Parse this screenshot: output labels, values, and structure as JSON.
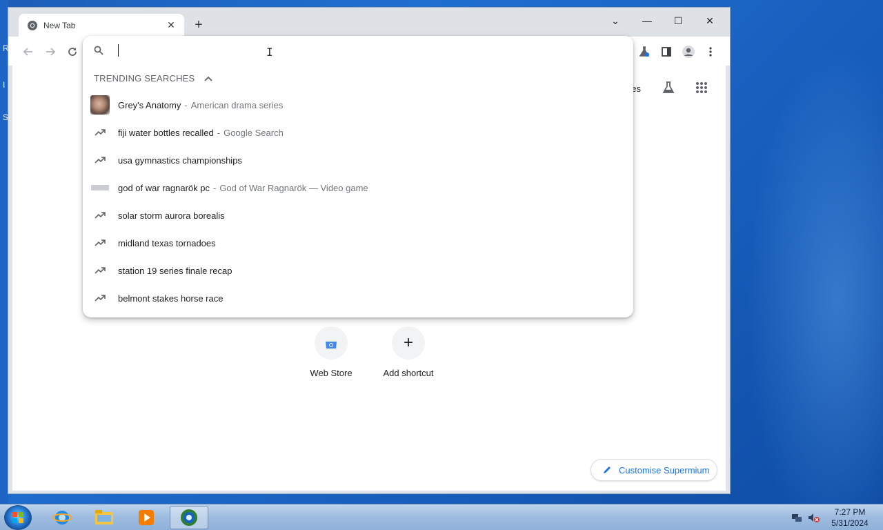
{
  "browser": {
    "tab": {
      "title": "New Tab"
    },
    "new_tab_symbol": "+",
    "window_controls": {
      "tab_search": "⌄",
      "minimize": "—",
      "maximize": "☐",
      "close": "✕"
    }
  },
  "omnibox": {
    "input_value": "",
    "section_title": "TRENDING SEARCHES",
    "suggestions": [
      {
        "main": "Grey's Anatomy",
        "separator": "-",
        "description": "American drama series",
        "icon": "photo-thumbnail"
      },
      {
        "main": "fiji water bottles recalled",
        "separator": "-",
        "description": "Google Search",
        "icon": "trending-icon"
      },
      {
        "main": "usa gymnastics championships",
        "separator": "",
        "description": "",
        "icon": "trending-icon"
      },
      {
        "main": "god of war ragnarök pc",
        "separator": "-",
        "description": "God of War Ragnarök — Video game",
        "icon": "logo-thumbnail"
      },
      {
        "main": "solar storm aurora borealis",
        "separator": "",
        "description": "",
        "icon": "trending-icon"
      },
      {
        "main": "midland texas tornadoes",
        "separator": "",
        "description": "",
        "icon": "trending-icon"
      },
      {
        "main": "station 19 series finale recap",
        "separator": "",
        "description": "",
        "icon": "trending-icon"
      },
      {
        "main": "belmont stakes horse race",
        "separator": "",
        "description": "",
        "icon": "trending-icon"
      }
    ]
  },
  "newtab": {
    "images_link_partial": "ges",
    "shortcuts": [
      {
        "label": "Web Store"
      },
      {
        "label": "Add shortcut",
        "symbol": "+"
      }
    ],
    "customise_label": "Customise Supermium"
  },
  "taskbar": {
    "time": "7:27 PM",
    "date": "5/31/2024"
  },
  "colors": {
    "accent": "#1a73e8",
    "desktop": "#1f6fd0"
  }
}
